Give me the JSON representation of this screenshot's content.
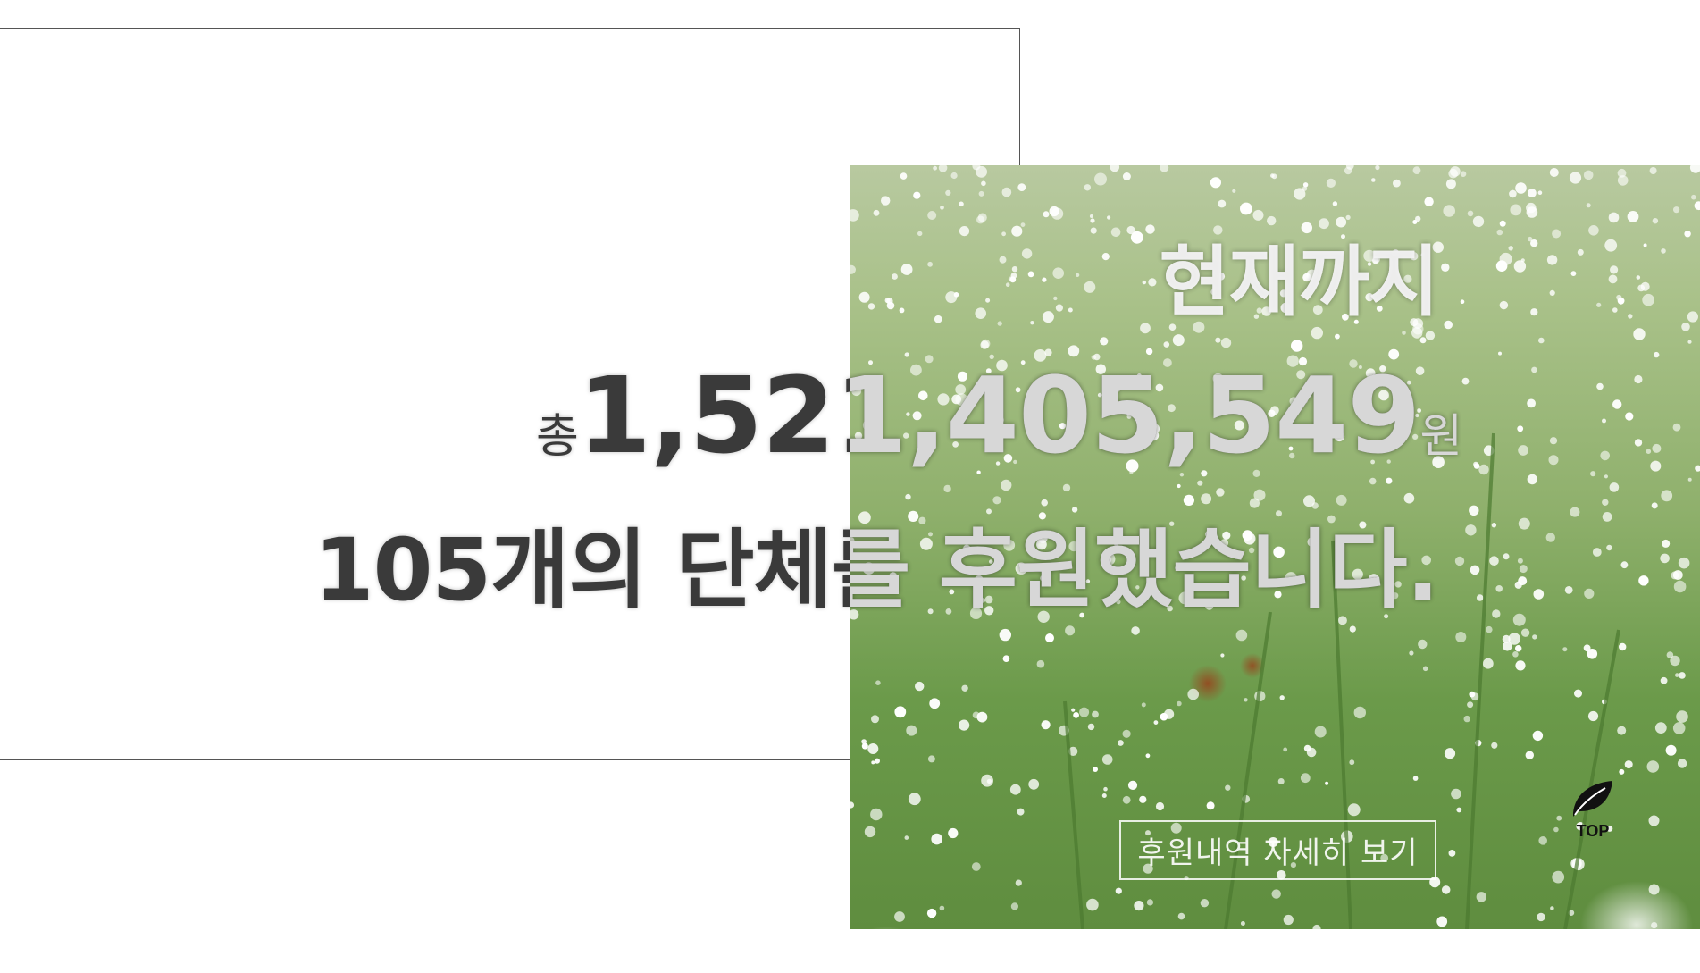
{
  "headline": {
    "line1": "현재까지",
    "prefix": "총",
    "amount": "1,521,405,549",
    "suffix": "원",
    "line3": "105개의 단체를 후원했습니다."
  },
  "detail_button": {
    "label": "후원내역 자세히 보기"
  },
  "top_button": {
    "label": "TOP",
    "icon": "leaf-icon"
  },
  "colors": {
    "text_dark": "#3a3a3a",
    "text_light": "#f5f5f5",
    "frame_border": "#555555"
  }
}
